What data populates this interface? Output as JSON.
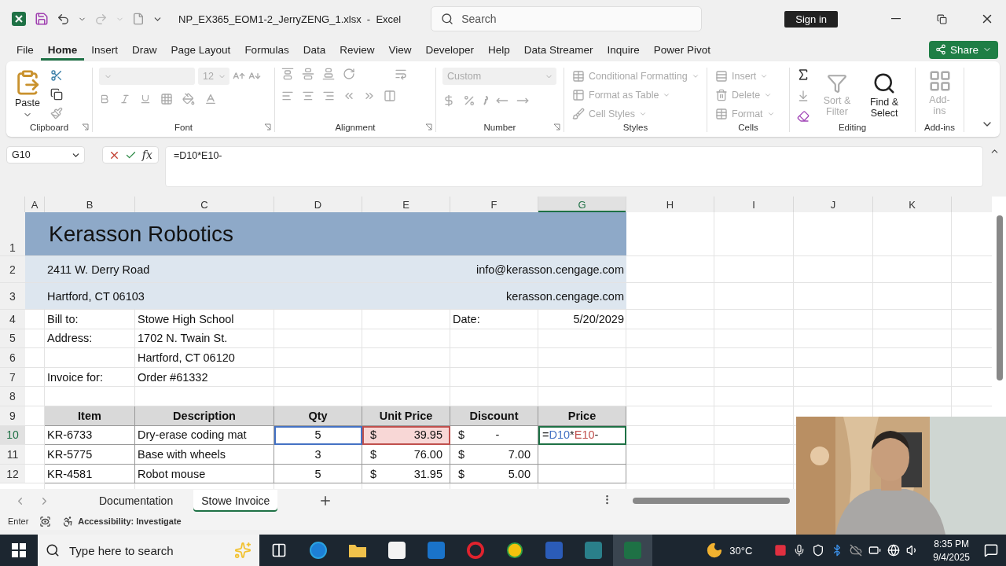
{
  "title_bar": {
    "title": "NP_EX365_EOM1-2_JerryZENG_1.xlsx  -  Excel",
    "search_placeholder": "Search",
    "sign_in": "Sign in"
  },
  "menu_tabs": [
    {
      "label": "File",
      "selected": false
    },
    {
      "label": "Home",
      "selected": true
    },
    {
      "label": "Insert",
      "selected": false
    },
    {
      "label": "Draw",
      "selected": false
    },
    {
      "label": "Page Layout",
      "selected": false
    },
    {
      "label": "Formulas",
      "selected": false
    },
    {
      "label": "Data",
      "selected": false
    },
    {
      "label": "Review",
      "selected": false
    },
    {
      "label": "View",
      "selected": false
    },
    {
      "label": "Developer",
      "selected": false
    },
    {
      "label": "Help",
      "selected": false
    },
    {
      "label": "Data Streamer",
      "selected": false
    },
    {
      "label": "Inquire",
      "selected": false
    },
    {
      "label": "Power Pivot",
      "selected": false
    }
  ],
  "share": "Share",
  "ribbon": [
    {
      "kind": "clipboard",
      "name": "Clipboard",
      "buttons": [
        {
          "label": "Paste",
          "disabled": false
        }
      ]
    },
    {
      "kind": "font",
      "name": "Font",
      "size": "12"
    },
    {
      "kind": "alignment",
      "name": "Alignment"
    },
    {
      "kind": "number",
      "name": "Number",
      "format": "Custom"
    },
    {
      "kind": "styles",
      "name": "Styles",
      "buttons": [
        {
          "label": "Conditional Formatting",
          "disabled": true
        },
        {
          "label": "Format as Table",
          "disabled": true
        },
        {
          "label": "Cell Styles",
          "disabled": true
        }
      ]
    },
    {
      "kind": "cells",
      "name": "Cells",
      "buttons": [
        {
          "label": "Insert",
          "disabled": true
        },
        {
          "label": "Delete",
          "disabled": true
        },
        {
          "label": "Format",
          "disabled": true
        }
      ]
    },
    {
      "kind": "editing",
      "name": "Editing",
      "buttons": [
        {
          "label": "Sort & Filter",
          "disabled": true
        },
        {
          "label": "Find & Select",
          "disabled": false
        }
      ]
    },
    {
      "kind": "addins",
      "name": "Add-ins",
      "buttons": [
        {
          "label": "Add-ins",
          "disabled": true
        }
      ]
    }
  ],
  "formula_bar": {
    "name_box": "G10",
    "fx": "fx",
    "formula": "=D10*E10-"
  },
  "columns": [
    {
      "label": "A",
      "selected": false
    },
    {
      "label": "B",
      "selected": false
    },
    {
      "label": "C",
      "selected": false
    },
    {
      "label": "D",
      "selected": false
    },
    {
      "label": "E",
      "selected": false
    },
    {
      "label": "F",
      "selected": false
    },
    {
      "label": "G",
      "selected": true
    },
    {
      "label": "H",
      "selected": false
    },
    {
      "label": "I",
      "selected": false
    },
    {
      "label": "J",
      "selected": false
    },
    {
      "label": "K",
      "selected": false
    }
  ],
  "rows": [
    {
      "number": "1",
      "kind": "title",
      "selected": false,
      "cells": [
        null,
        {
          "kind": "title",
          "text": "Kerasson Robotics"
        }
      ]
    },
    {
      "number": "2",
      "kind": "address",
      "selected": false,
      "cells": [
        null,
        {
          "kind": "text",
          "text": "2411 W. Derry Road"
        },
        null,
        null,
        null,
        null,
        {
          "kind": "right",
          "text": "info@kerasson.cengage.com"
        }
      ]
    },
    {
      "number": "3",
      "kind": "address",
      "selected": false,
      "cells": [
        null,
        {
          "kind": "text",
          "text": "Hartford, CT 06103"
        },
        null,
        null,
        null,
        null,
        {
          "kind": "right",
          "text": "kerasson.cengage.com"
        }
      ]
    },
    {
      "number": "4",
      "kind": "plain",
      "selected": false,
      "cells": [
        null,
        {
          "kind": "text",
          "text": "Bill to:"
        },
        {
          "kind": "text",
          "text": "Stowe High School"
        },
        null,
        null,
        {
          "kind": "text",
          "text": "Date:"
        },
        {
          "kind": "right",
          "text": "5/20/2029"
        }
      ]
    },
    {
      "number": "5",
      "kind": "plain",
      "selected": false,
      "cells": [
        null,
        {
          "kind": "text",
          "text": "Address:"
        },
        {
          "kind": "text",
          "text": "1702 N. Twain St."
        }
      ]
    },
    {
      "number": "6",
      "kind": "plain",
      "selected": false,
      "cells": [
        null,
        null,
        {
          "kind": "text",
          "text": "Hartford, CT 06120"
        }
      ]
    },
    {
      "number": "7",
      "kind": "plain",
      "selected": false,
      "cells": [
        null,
        {
          "kind": "text",
          "text": "Invoice for:"
        },
        {
          "kind": "text",
          "text": "Order #61332"
        }
      ]
    },
    {
      "number": "8",
      "kind": "plain",
      "selected": false,
      "cells": []
    },
    {
      "number": "9",
      "kind": "header",
      "selected": false,
      "cells": [
        null,
        {
          "kind": "center",
          "text": "Item"
        },
        {
          "kind": "center",
          "text": "Description"
        },
        {
          "kind": "center",
          "text": "Qty"
        },
        {
          "kind": "center",
          "text": "Unit Price"
        },
        {
          "kind": "center",
          "text": "Discount"
        },
        {
          "kind": "center",
          "text": "Price"
        }
      ]
    },
    {
      "number": "10",
      "kind": "item",
      "selected": true,
      "cells": [
        null,
        {
          "kind": "text",
          "text": "KR-6733"
        },
        {
          "kind": "text",
          "text": "Dry-erase coding mat"
        },
        {
          "kind": "center",
          "text": "5",
          "color": "#4472c4"
        },
        {
          "kind": "currency",
          "symbol": "$",
          "text": "39.95",
          "color": "#c0504d"
        },
        {
          "kind": "currency",
          "symbol": "$",
          "text": "-"
        },
        {
          "kind": "formula",
          "parts": [
            {
              "text": "="
            },
            {
              "text": "D10",
              "color": "#4472c4"
            },
            {
              "text": "*"
            },
            {
              "text": "E10",
              "color": "#c0504d"
            },
            {
              "text": "-"
            }
          ]
        }
      ]
    },
    {
      "number": "11",
      "kind": "item",
      "selected": false,
      "cells": [
        null,
        {
          "kind": "text",
          "text": "KR-5775"
        },
        {
          "kind": "text",
          "text": "Base with wheels"
        },
        {
          "kind": "center",
          "text": "3"
        },
        {
          "kind": "currency",
          "symbol": "$",
          "text": "76.00"
        },
        {
          "kind": "currency",
          "symbol": "$",
          "text": "7.00"
        },
        null
      ]
    },
    {
      "number": "12",
      "kind": "item",
      "selected": false,
      "cells": [
        null,
        {
          "kind": "text",
          "text": "KR-4581"
        },
        {
          "kind": "text",
          "text": "Robot mouse"
        },
        {
          "kind": "center",
          "text": "5"
        },
        {
          "kind": "currency",
          "symbol": "$",
          "text": "31.95"
        },
        {
          "kind": "currency",
          "symbol": "$",
          "text": "5.00"
        },
        null
      ]
    }
  ],
  "sheet_tabs": [
    {
      "label": "Documentation",
      "selected": false
    },
    {
      "label": "Stowe Invoice",
      "selected": true
    }
  ],
  "status_bar": {
    "mode": "Enter",
    "accessibility": "Accessibility: Investigate"
  },
  "taskbar": {
    "search_placeholder": "Type here to search",
    "temperature": "30°C",
    "time": "8:35 PM",
    "date": "9/4/2025"
  }
}
